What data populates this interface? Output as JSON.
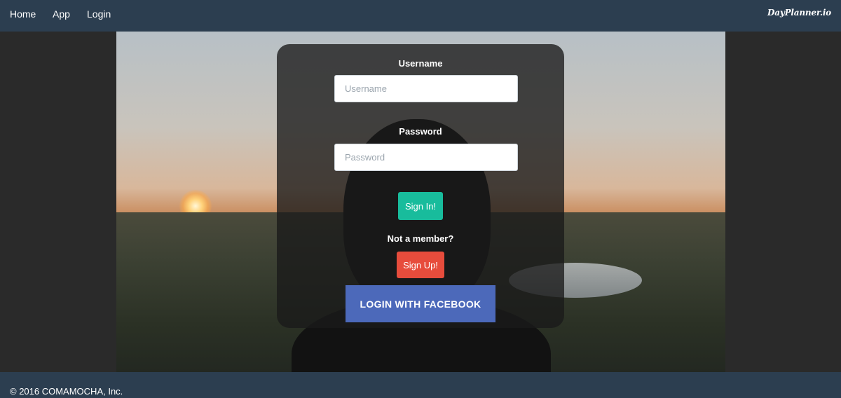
{
  "navbar": {
    "links": [
      {
        "label": "Home"
      },
      {
        "label": "App"
      },
      {
        "label": "Login"
      }
    ],
    "brand": "DayPlanner.io"
  },
  "login": {
    "username_label": "Username",
    "username_placeholder": "Username",
    "username_value": "",
    "password_label": "Password",
    "password_placeholder": "Password",
    "password_value": "",
    "signin_label": "Sign In!",
    "member_prompt": "Not a member?",
    "signup_label": "Sign Up!",
    "facebook_label": "LOGIN WITH FACEBOOK"
  },
  "footer": {
    "copyright": "© 2016 COMAMOCHA, Inc."
  },
  "colors": {
    "navbar": "#2c3e50",
    "signin": "#18bc9c",
    "signup": "#e74c3c",
    "facebook": "#4c69ba"
  }
}
